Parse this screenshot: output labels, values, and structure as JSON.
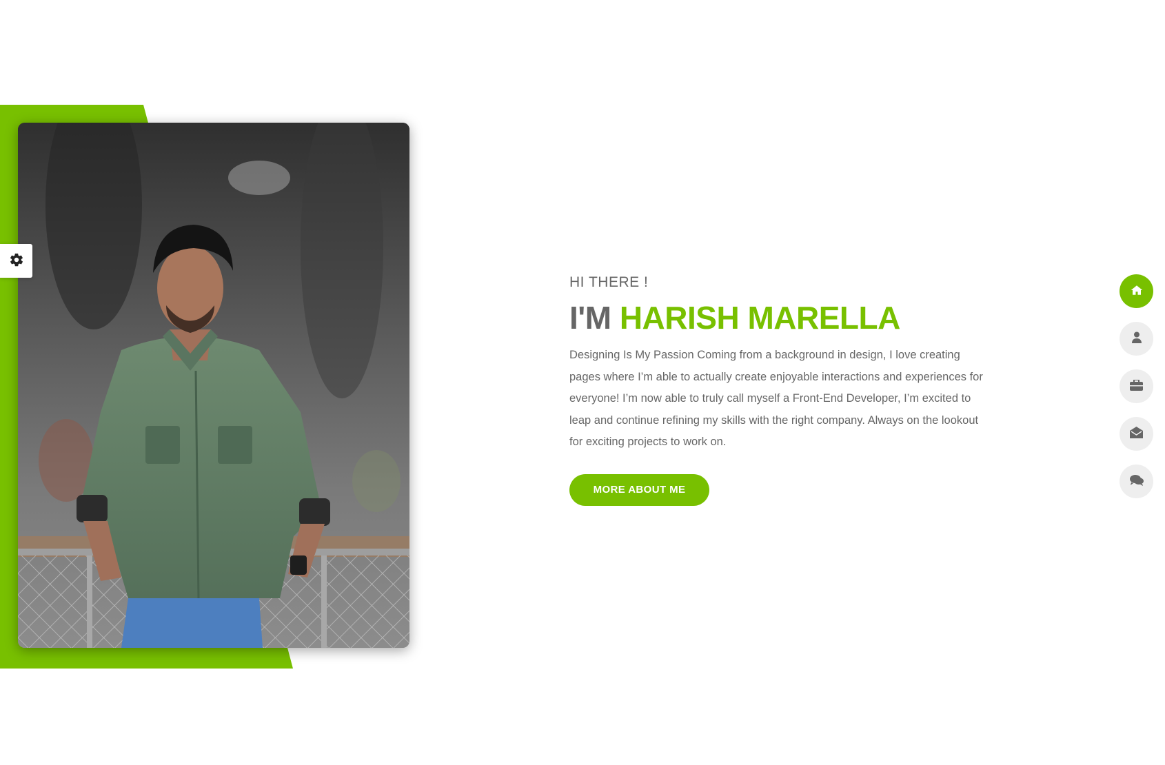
{
  "colors": {
    "accent": "#78c000",
    "text_gray": "#666666",
    "nav_bg": "#eeeeee"
  },
  "settings": {
    "icon": "gear-icon"
  },
  "photo": {
    "alt": "Portrait photo"
  },
  "intro": {
    "greeting": "HI THERE !",
    "name_prefix": "I'M",
    "name": "HARISH MARELLA",
    "bio": "Designing Is My Passion Coming from a background in design, I love creating pages where I’m able to actually create enjoyable interactions and experiences for everyone! I’m now able to truly call myself a Front-End Developer, I’m excited to leap and continue refining my skills with the right company. Always on the lookout for exciting projects to work on.",
    "button_label": "MORE ABOUT ME"
  },
  "side_nav": [
    {
      "icon": "home-icon",
      "active": true
    },
    {
      "icon": "user-icon",
      "active": false
    },
    {
      "icon": "briefcase-icon",
      "active": false
    },
    {
      "icon": "envelope-open-icon",
      "active": false
    },
    {
      "icon": "comments-icon",
      "active": false
    }
  ]
}
